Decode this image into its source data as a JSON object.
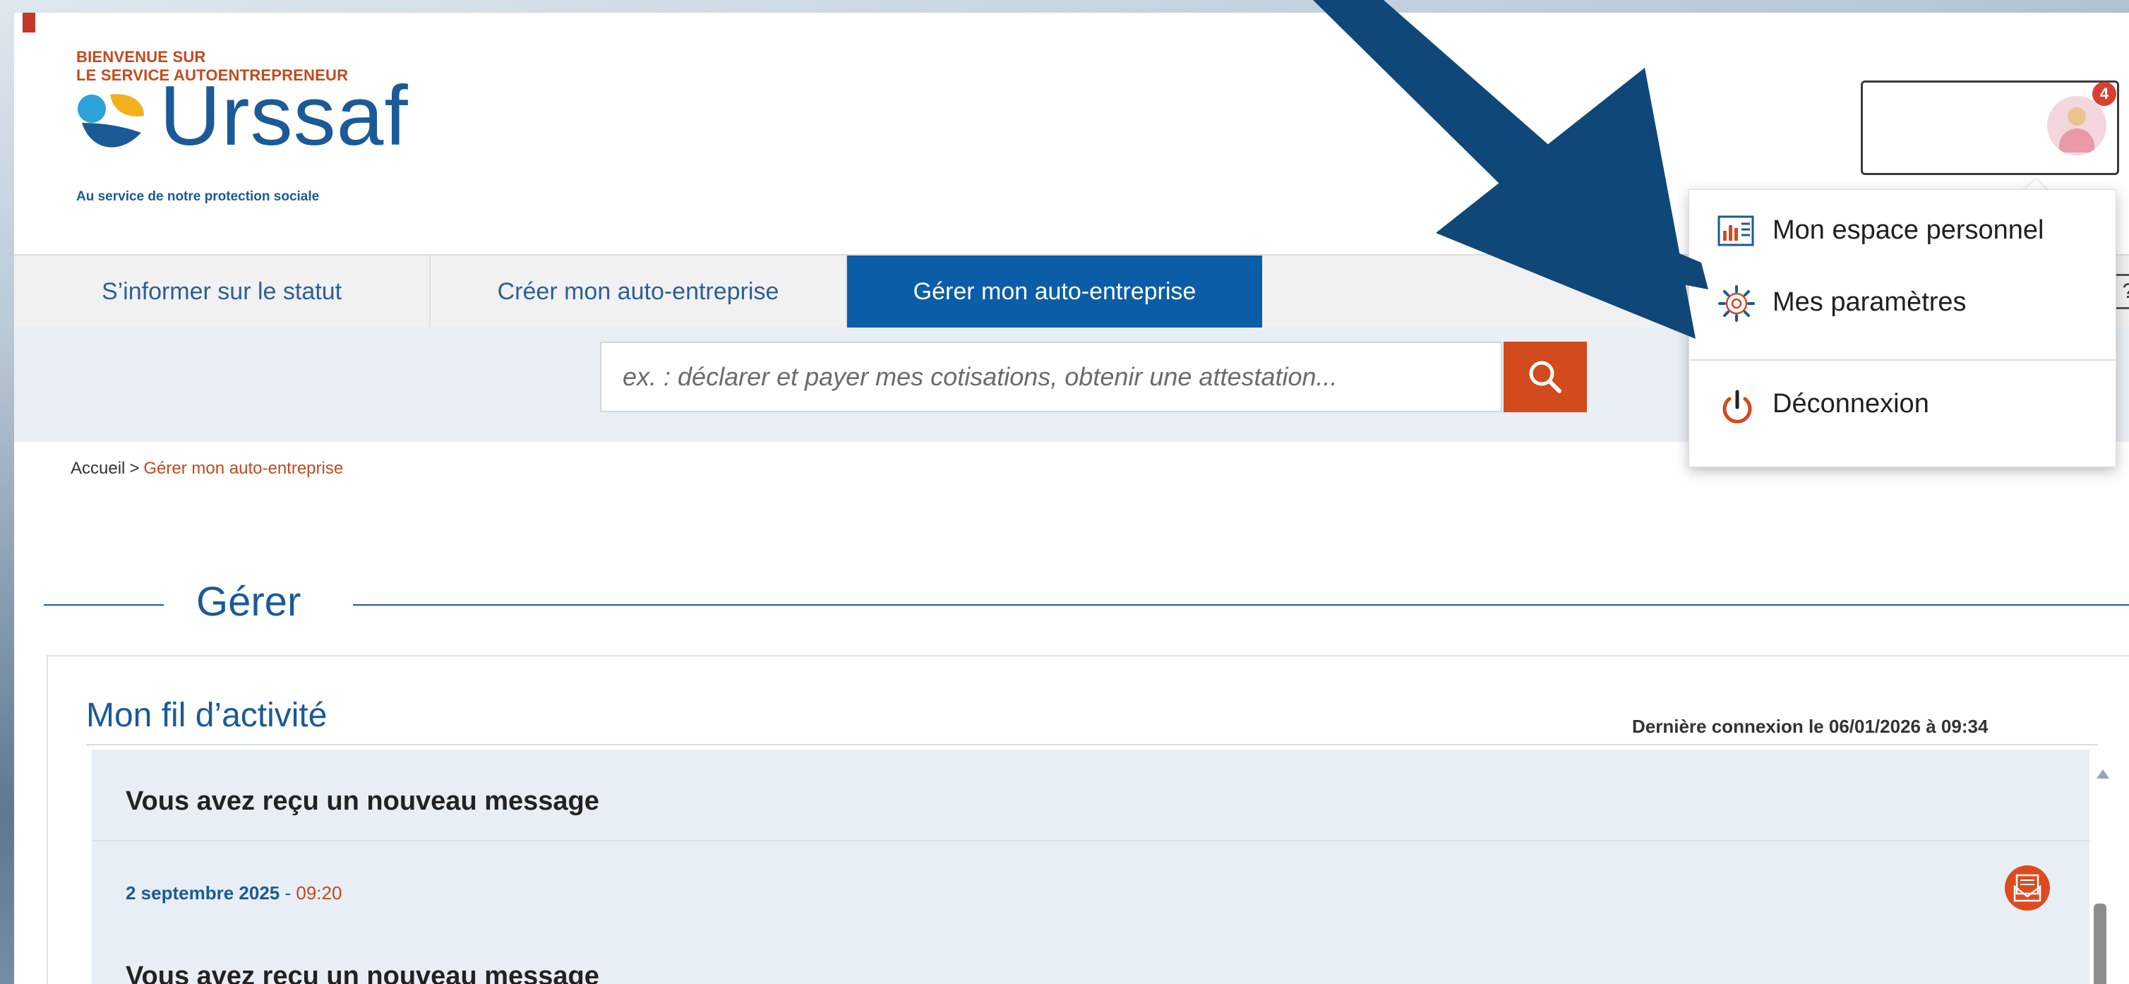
{
  "header": {
    "welcome_line1": "BIENVENUE SUR",
    "welcome_line2": "LE SERVICE AUTOENTREPRENEUR",
    "logo_text": "Urssaf",
    "tagline": "Au service de notre protection sociale",
    "notification_count": "4"
  },
  "nav": {
    "tabs": [
      {
        "label": "S’informer sur le statut",
        "active": false
      },
      {
        "label": "Créer mon auto-entreprise",
        "active": false
      },
      {
        "label": "Gérer mon auto-entreprise",
        "active": true
      }
    ],
    "help_label": "?"
  },
  "search": {
    "placeholder": "ex. : déclarer et payer mes cotisations, obtenir une attestation..."
  },
  "breadcrumb": {
    "home": "Accueil",
    "separator": ">",
    "current": "Gérer mon auto-entreprise"
  },
  "section": {
    "title": "Gérer"
  },
  "activity": {
    "title": "Mon fil d’activité",
    "last_connection": "Dernière connexion le 06/01/2026 à 09:34",
    "items": [
      {
        "title": "Vous avez reçu un nouveau message"
      },
      {
        "date": "2 septembre 2025",
        "dash": " - ",
        "time": "09:20",
        "title": "Vous avez reçu un nouveau message"
      }
    ]
  },
  "user_menu": {
    "items": [
      {
        "label": "Mon espace personnel",
        "icon": "dashboard-icon"
      },
      {
        "label": "Mes paramètres",
        "icon": "gear-icon"
      },
      {
        "label": "Déconnexion",
        "icon": "power-icon"
      }
    ]
  },
  "colors": {
    "brand_blue": "#1b5a96",
    "active_tab": "#0b5da7",
    "accent_orange": "#d24a1e",
    "annotation_arrow": "#0f4778"
  }
}
